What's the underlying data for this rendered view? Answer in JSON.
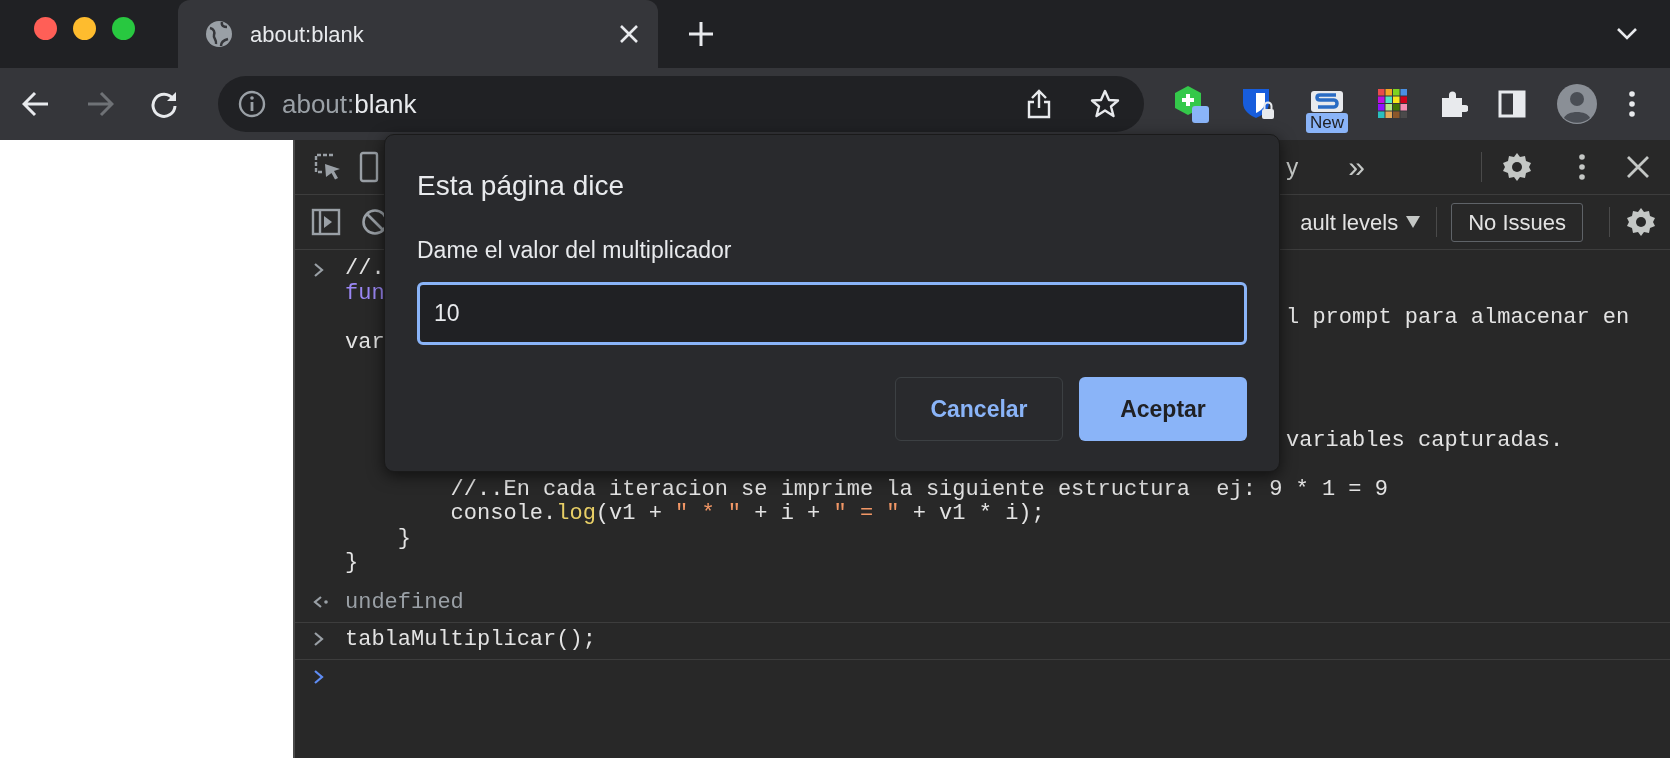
{
  "browser": {
    "tabs": [
      {
        "title": "about:blank",
        "selected": true
      }
    ],
    "navigation": {
      "back_disabled": false,
      "forward_disabled": true
    },
    "address_bar": {
      "scheme": "about:",
      "host": "blank"
    },
    "extension_badge": "New"
  },
  "devtools": {
    "toolbar": {
      "partial_tab": "y",
      "more_tabs": "»"
    },
    "console_toolbar": {
      "levels": "ault levels",
      "issues": "No Issues"
    },
    "console": {
      "input_lines": [
        {
          "kind": "code",
          "tokens": [
            {
              "text": "//.",
              "kind": "plain"
            }
          ]
        },
        {
          "kind": "code",
          "tokens": [
            {
              "text": "fun",
              "kind": "keyword"
            }
          ]
        },
        {
          "kind": "code",
          "tail": "l prompt para almacenar en"
        },
        {
          "kind": "code",
          "tokens": [
            {
              "text": "var",
              "kind": "plain"
            }
          ]
        },
        {
          "kind": "covered"
        },
        {
          "kind": "covered"
        },
        {
          "kind": "covered"
        },
        {
          "kind": "code",
          "tail": "variables capturadas."
        },
        {
          "kind": "covered"
        },
        {
          "kind": "code",
          "tokens": [
            {
              "text": "        //..En cada iteracion se imprime la siguiente estructura  ej: 9 * 1 = 9",
              "kind": "plain"
            }
          ]
        },
        {
          "kind": "code",
          "tokens": [
            {
              "text": "        console.",
              "kind": "plain"
            },
            {
              "text": "log",
              "kind": "method"
            },
            {
              "text": "(v1 + ",
              "kind": "plain"
            },
            {
              "text": "\" * \"",
              "kind": "string"
            },
            {
              "text": " + i + ",
              "kind": "plain"
            },
            {
              "text": "\" = \"",
              "kind": "string"
            },
            {
              "text": " + v1 * i);",
              "kind": "plain"
            }
          ]
        },
        {
          "kind": "code",
          "tokens": [
            {
              "text": "    }",
              "kind": "plain"
            }
          ]
        },
        {
          "kind": "code",
          "tokens": [
            {
              "text": "}",
              "kind": "plain"
            }
          ]
        }
      ],
      "result": "undefined",
      "command": "tablaMultiplicar();"
    }
  },
  "dialog": {
    "title": "Esta página dice",
    "message": "Dame el valor del multiplicador",
    "input_value": "10",
    "buttons": [
      {
        "label": "Cancelar",
        "kind": "secondary"
      },
      {
        "label": "Aceptar",
        "kind": "primary"
      }
    ]
  }
}
